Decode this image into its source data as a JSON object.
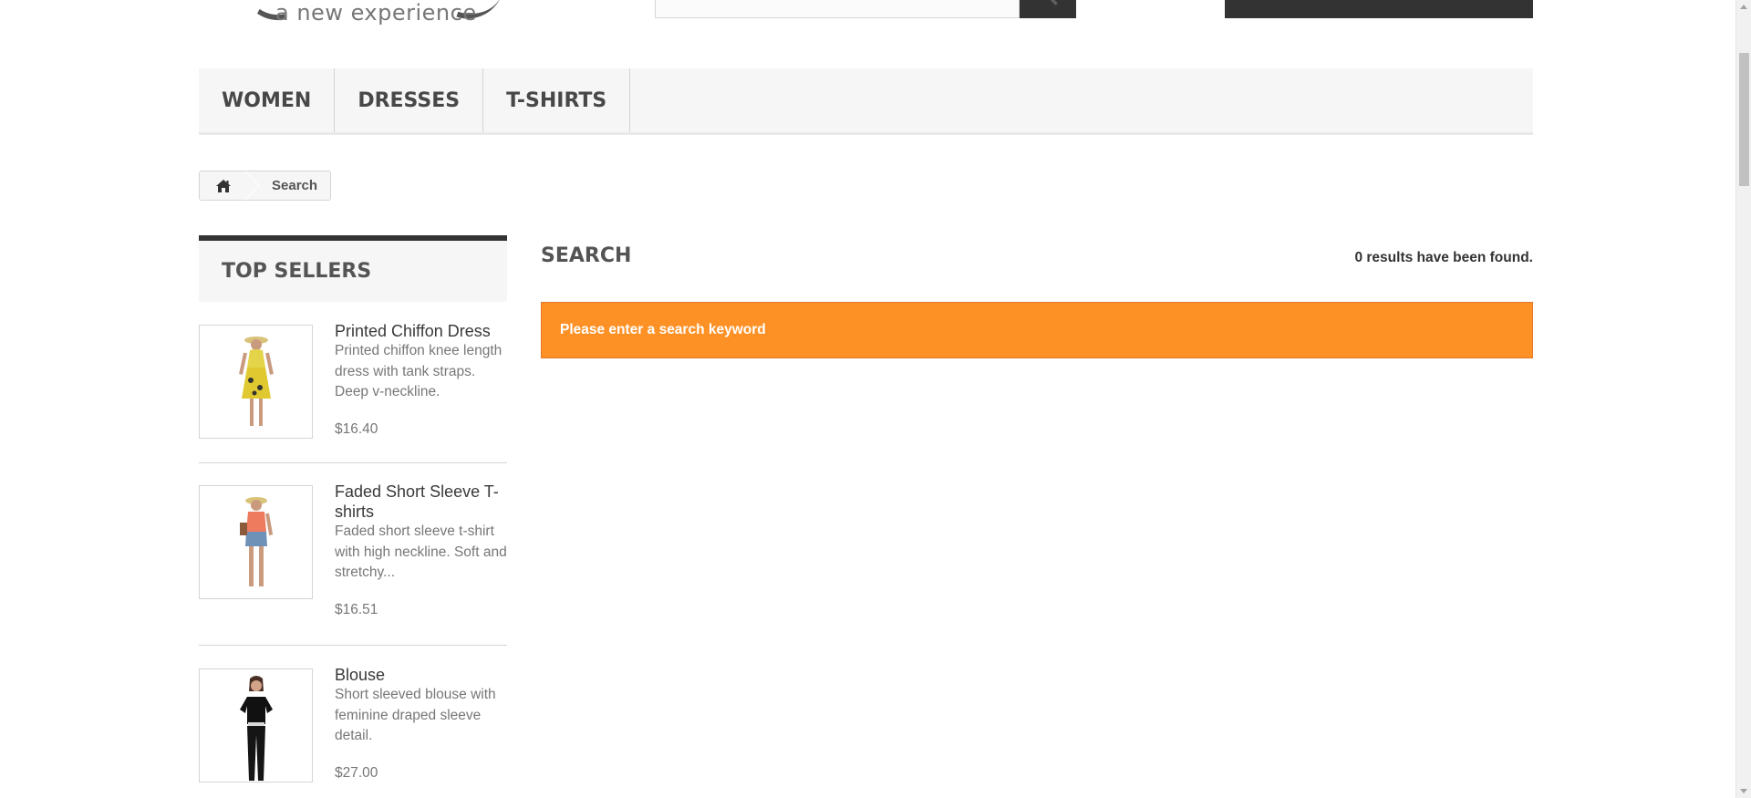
{
  "header": {
    "logo_tagline": "a new experience",
    "search_placeholder": "",
    "search_icon": "search-icon",
    "cart_icon": "cart-icon"
  },
  "top_menu": {
    "items": [
      {
        "label": "Women"
      },
      {
        "label": "Dresses"
      },
      {
        "label": "T-shirts"
      }
    ]
  },
  "breadcrumb": {
    "home_icon": "home-icon",
    "current": "Search"
  },
  "left_column": {
    "block_title": "Top sellers",
    "products": [
      {
        "name": "Printed Chiffon Dress",
        "description": "Printed chiffon knee length dress with tank straps. Deep v-neckline.",
        "price": "$16.40",
        "image_icon": "product-photo-yellow-dress"
      },
      {
        "name": "Faded Short Sleeve T-shirts",
        "description": "Faded short sleeve t-shirt with high neckline. Soft and stretchy...",
        "price": "$16.51",
        "image_icon": "product-photo-orange-tshirt"
      },
      {
        "name": "Blouse",
        "description": "Short sleeved blouse with feminine draped sleeve detail.",
        "price": "$27.00",
        "image_icon": "product-photo-black-blouse"
      }
    ]
  },
  "main": {
    "heading": "Search",
    "results_count": "0 results have been found.",
    "alert": "Please enter a search keyword",
    "alert_color": "#fe9126"
  }
}
